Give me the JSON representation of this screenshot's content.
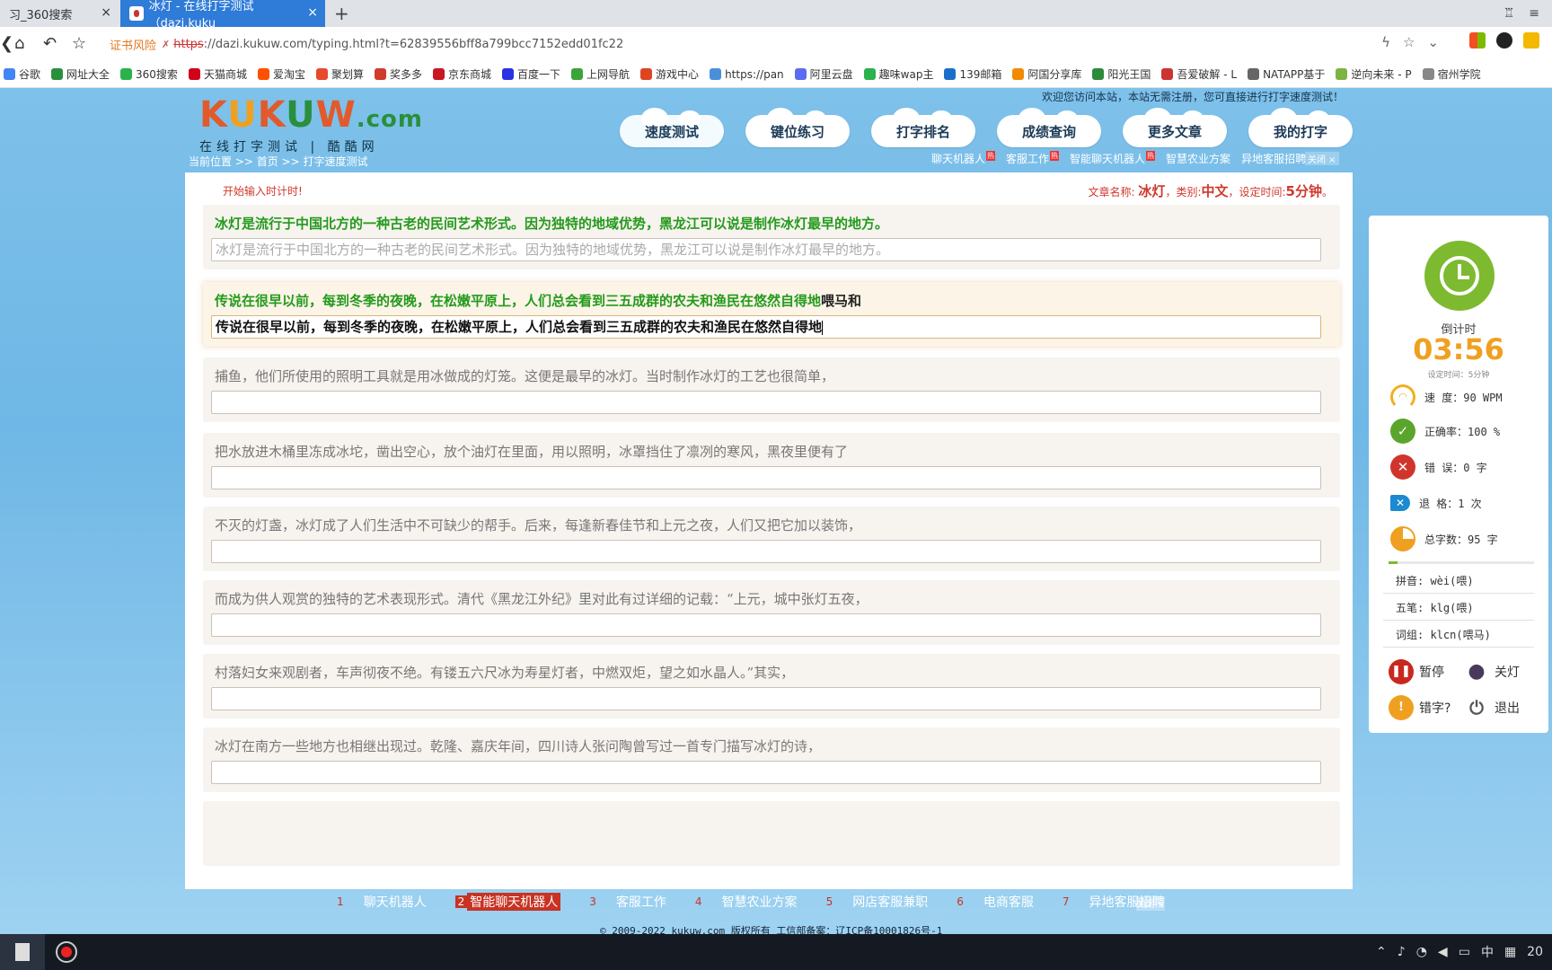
{
  "browser": {
    "tabs": [
      {
        "title": "习_360搜索",
        "active": false
      },
      {
        "title": "冰灯 - 在线打字测试（dazi.kuku",
        "active": true
      }
    ],
    "address": {
      "cert_warning": "证书风险",
      "protocol": "https",
      "url_rest": "://dazi.kukuw.com/typing.html?t=62839556bff8a799bcc7152edd01fc22"
    },
    "bookmarks": [
      {
        "label": "谷歌",
        "color": "#4285f4"
      },
      {
        "label": "网址大全",
        "color": "#2a8f3c"
      },
      {
        "label": "360搜索",
        "color": "#2bb24c"
      },
      {
        "label": "天猫商城",
        "color": "#d0021b"
      },
      {
        "label": "爱淘宝",
        "color": "#ff5000"
      },
      {
        "label": "聚划算",
        "color": "#e8492e"
      },
      {
        "label": "奖多多",
        "color": "#d03b2b"
      },
      {
        "label": "京东商城",
        "color": "#c81623"
      },
      {
        "label": "百度一下",
        "color": "#2932e1"
      },
      {
        "label": "上网导航",
        "color": "#3aa43a"
      },
      {
        "label": "游戏中心",
        "color": "#d42"
      },
      {
        "label": "https://pan",
        "color": "#4a90d9"
      },
      {
        "label": "阿里云盘",
        "color": "#5b6cf0"
      },
      {
        "label": "趣味wap主",
        "color": "#2bb24c"
      },
      {
        "label": "139邮箱",
        "color": "#1b6fc8"
      },
      {
        "label": "阿国分享库",
        "color": "#f28a00"
      },
      {
        "label": "阳光王国",
        "color": "#2b8a3c"
      },
      {
        "label": "吾爱破解 - L",
        "color": "#c33"
      },
      {
        "label": "NATAPP基于",
        "color": "#666"
      },
      {
        "label": "逆向未来 - P",
        "color": "#7cb342"
      },
      {
        "label": "宿州学院",
        "color": "#888"
      }
    ]
  },
  "site": {
    "logo": {
      "k1": "K",
      "u1": "U",
      "k2": "K",
      "u2": "U",
      "w": "W",
      "com": ".com",
      "subtitle": "在线打字测试 | 酷酷网"
    },
    "welcome": "欢迎您访问本站，本站无需注册，您可直接进行打字速度测试！",
    "nav": [
      "速度测试",
      "键位练习",
      "打字排名",
      "成绩查询",
      "更多文章",
      "我的打字"
    ],
    "breadcrumb": "当前位置 >> 首页 >> 打字速度测试",
    "top_links": [
      "聊天机器人",
      "客服工作",
      "智能聊天机器人",
      "智慧农业方案",
      "异地客服招聘"
    ],
    "top_hot": "热",
    "ad_close": "关闭 ×"
  },
  "typing": {
    "hint": "开始输入时计时!",
    "info_prefix": "文章名称:",
    "article_name": "冰灯",
    "category_prefix": "，类别:",
    "category": "中文",
    "time_prefix": "，设定时间:",
    "time": "5分钟",
    "time_suffix": "。",
    "rows": [
      {
        "source": "冰灯是流行于中国北方的一种古老的民间艺术形式。因为独特的地域优势，黑龙江可以说是制作冰灯最早的地方。",
        "input": "冰灯是流行于中国北方的一种古老的民间艺术形式。因为独特的地域优势，黑龙江可以说是制作冰灯最早的地方。",
        "state": "done"
      },
      {
        "source_typed": "传说在很早以前，每到冬季的夜晚，在松嫩平原上，人们总会看到三五成群的农夫和渔民在悠然自得地",
        "source_rest": "喂马和",
        "input": "传说在很早以前，每到冬季的夜晚，在松嫩平原上，人们总会看到三五成群的农夫和渔民在悠然自得地",
        "state": "current"
      },
      {
        "source": "捕鱼，他们所使用的照明工具就是用冰做成的灯笼。这便是最早的冰灯。当时制作冰灯的工艺也很简单，",
        "input": "",
        "state": "pending"
      },
      {
        "source": "把水放进木桶里冻成冰坨，凿出空心，放个油灯在里面，用以照明，冰罩挡住了凛冽的寒风，黑夜里便有了",
        "input": "",
        "state": "pending"
      },
      {
        "source": "不灭的灯盏，冰灯成了人们生活中不可缺少的帮手。后来，每逢新春佳节和上元之夜，人们又把它加以装饰，",
        "input": "",
        "state": "pending"
      },
      {
        "source": "而成为供人观赏的独特的艺术表现形式。清代《黑龙江外纪》里对此有过详细的记载：“上元，城中张灯五夜，",
        "input": "",
        "state": "pending"
      },
      {
        "source": "村落妇女来观剧者，车声彻夜不绝。有镂五六尺冰为寿星灯者，中燃双炬，望之如水晶人。”其实，",
        "input": "",
        "state": "pending"
      },
      {
        "source": "冰灯在南方一些地方也相继出现过。乾隆、嘉庆年间，四川诗人张问陶曾写过一首专门描写冰灯的诗，",
        "input": "",
        "state": "pending"
      }
    ]
  },
  "sidebar": {
    "countdown_label": "倒计时",
    "countdown_time": "03:56",
    "set_time": "设定时间：5分钟",
    "stats": [
      {
        "icon": "speed-gauge-icon",
        "label": "速  度：90 WPM"
      },
      {
        "icon": "check-icon",
        "label": "正确率：100 %"
      },
      {
        "icon": "error-icon",
        "label": "错  误：0 字"
      },
      {
        "icon": "backspace-icon",
        "label": "退  格：1 次"
      },
      {
        "icon": "pie-icon",
        "label": "总字数：95 字"
      }
    ],
    "progress": 0.06,
    "pinyin": "拼音: wèi(喂)",
    "wubi": "五笔: klg(喂)",
    "phrase": "词组: klcn(喂马)",
    "controls": {
      "pause": "暂停",
      "light": "关灯",
      "typo": "错字?",
      "exit": "退出"
    }
  },
  "footer": {
    "links": [
      {
        "num": "1",
        "label": "聊天机器人"
      },
      {
        "num": "2",
        "label": "智能聊天机器人",
        "highlight": true
      },
      {
        "num": "3",
        "label": "客服工作"
      },
      {
        "num": "4",
        "label": "智慧农业方案"
      },
      {
        "num": "5",
        "label": "网店客服兼职"
      },
      {
        "num": "6",
        "label": "电商客服"
      },
      {
        "num": "7",
        "label": "异地客服招聘"
      }
    ],
    "close": "关闭 ×",
    "copyright": "© 2009-2022 kukuw.com 版权所有 工信部备案：辽ICP备10001826号-1"
  },
  "taskbar": {
    "ime": "中",
    "clock": "20"
  },
  "colors": {
    "accent_green": "#249a1c",
    "accent_red": "#d0382b",
    "countdown": "#f0a020",
    "clock_green": "#7dba2f"
  }
}
